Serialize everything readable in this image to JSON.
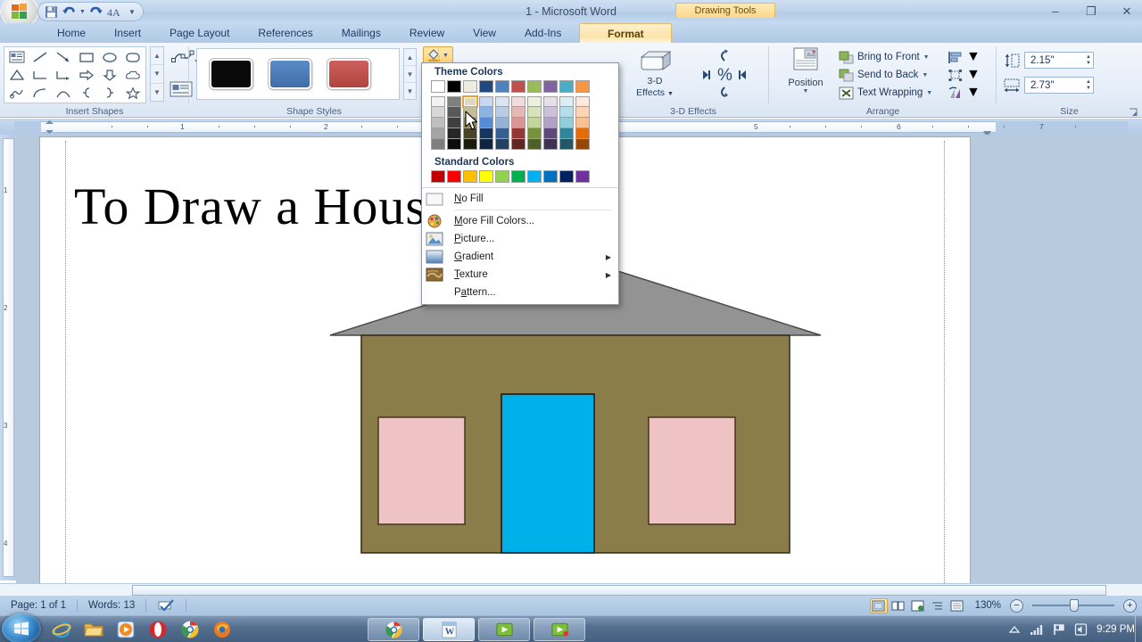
{
  "window": {
    "title": "1 - Microsoft Word",
    "contextual_tab_title": "Drawing Tools",
    "minimize": "–",
    "restore": "❐",
    "close": "✕"
  },
  "quick_access": {
    "office_button": "office-button",
    "items": [
      "save-icon",
      "undo-icon",
      "undo-dropdown",
      "redo-icon",
      "font-icon",
      "qat-dropdown"
    ]
  },
  "tabs": [
    {
      "label": "Home",
      "active": false
    },
    {
      "label": "Insert",
      "active": false
    },
    {
      "label": "Page Layout",
      "active": false
    },
    {
      "label": "References",
      "active": false
    },
    {
      "label": "Mailings",
      "active": false
    },
    {
      "label": "Review",
      "active": false
    },
    {
      "label": "View",
      "active": false
    },
    {
      "label": "Add-Ins",
      "active": false
    },
    {
      "label": "Format",
      "active": true
    }
  ],
  "ribbon": {
    "groups": [
      {
        "id": "insert-shapes",
        "label": "Insert Shapes"
      },
      {
        "id": "shape-styles",
        "label": "Shape Styles"
      },
      {
        "id": "three-d-effects",
        "label": "3-D Effects"
      },
      {
        "id": "arrange",
        "label": "Arrange"
      },
      {
        "id": "size",
        "label": "Size"
      }
    ],
    "shape_styles": {
      "swatches": [
        "#0a0a0a",
        "#4a7ebb",
        "#c0504d"
      ],
      "scroll": [
        "▲",
        "▼",
        "▼̱"
      ]
    },
    "three_d": {
      "button_line1": "3-D",
      "button_line2": "Effects"
    },
    "arrange": {
      "position": "Position",
      "bring_to_front": "Bring to Front",
      "send_to_back": "Send to Back",
      "text_wrapping": "Text Wrapping"
    },
    "size": {
      "height_value": "2.15\"",
      "width_value": "2.73\""
    }
  },
  "fill_menu": {
    "theme_colors_header": "Theme Colors",
    "standard_colors_header": "Standard Colors",
    "theme_top_row": [
      "#ffffff",
      "#000000",
      "#eeece1",
      "#1f497d",
      "#4f81bd",
      "#c0504d",
      "#9bbb59",
      "#8064a2",
      "#4bacc6",
      "#f79646"
    ],
    "theme_variants": [
      [
        "#f2f2f2",
        "#d8d8d8",
        "#bfbfbf",
        "#a5a5a5",
        "#7f7f7f"
      ],
      [
        "#7f7f7f",
        "#595959",
        "#3f3f3f",
        "#262626",
        "#0c0c0c"
      ],
      [
        "#ddd9c3",
        "#c4bd97",
        "#938953",
        "#494429",
        "#1d1b10"
      ],
      [
        "#c6d9f0",
        "#8db3e2",
        "#548dd4",
        "#17365d",
        "#0f243e"
      ],
      [
        "#dbe5f1",
        "#b8cce4",
        "#95b3d7",
        "#366092",
        "#244061"
      ],
      [
        "#f2dcdb",
        "#e5b8b7",
        "#d99694",
        "#953734",
        "#632423"
      ],
      [
        "#ebf1dd",
        "#d7e3bc",
        "#c3d69b",
        "#76923c",
        "#4f6128"
      ],
      [
        "#e5e0ec",
        "#ccc1d9",
        "#b2a1c7",
        "#5f497a",
        "#3f3151"
      ],
      [
        "#dbeef3",
        "#b7dde8",
        "#92cddc",
        "#31859b",
        "#205867"
      ],
      [
        "#fdeada",
        "#fbd5b5",
        "#fac08f",
        "#e36c09",
        "#974806"
      ]
    ],
    "hovered_swatch": {
      "column": 2,
      "row": 0
    },
    "standard_colors": [
      "#c00000",
      "#ff0000",
      "#ffc000",
      "#ffff00",
      "#92d050",
      "#00b050",
      "#00b0f0",
      "#0070c0",
      "#002060",
      "#7030a0"
    ],
    "items": [
      {
        "label": "No Fill",
        "accel": "N",
        "icon": "no-fill-icon",
        "submenu": false
      },
      {
        "label": "More Fill Colors...",
        "accel": "M",
        "icon": "more-colors-icon",
        "submenu": false
      },
      {
        "label": "Picture...",
        "accel": "P",
        "icon": "picture-icon",
        "submenu": false
      },
      {
        "label": "Gradient",
        "accel": "G",
        "icon": "gradient-icon",
        "submenu": true
      },
      {
        "label": "Texture",
        "accel": "T",
        "icon": "texture-icon",
        "submenu": true
      },
      {
        "label": "Pattern...",
        "accel": "a",
        "icon": "pattern-icon",
        "submenu": false
      }
    ]
  },
  "ruler": {
    "h_ticks": [
      "1",
      "2",
      "5",
      "6",
      "7"
    ],
    "v_ticks": [
      "1",
      "2",
      "3",
      "4"
    ]
  },
  "document": {
    "heading": "To Draw a House",
    "drawing": {
      "name": "house-shape",
      "roof_color": "#939393",
      "body_color": "#8a7d4a",
      "door_color": "#00b0e8",
      "window_color": "#efc2c4",
      "outline_color": "#3b2f18"
    }
  },
  "status_bar": {
    "page": "Page: 1 of 1",
    "words": "Words: 13",
    "proofing_icon": "proofing-errors-icon",
    "zoom_level": "130%",
    "zoom_out": "−",
    "zoom_in": "+",
    "views": [
      "print-layout",
      "full-screen-reading",
      "web-layout",
      "outline",
      "draft"
    ],
    "selected_view": "print-layout"
  },
  "taskbar": {
    "start": "start-orb",
    "quicklaunch": [
      "internet-explorer",
      "windows-explorer",
      "windows-media-player",
      "opera",
      "chrome",
      "firefox"
    ],
    "windows": [
      "chrome-window",
      "word-window",
      "media-window-1",
      "media-window-2"
    ],
    "tray": [
      "show-hidden-icons",
      "network-signal",
      "action-flag",
      "volume"
    ],
    "clock": "9:29 PM"
  }
}
